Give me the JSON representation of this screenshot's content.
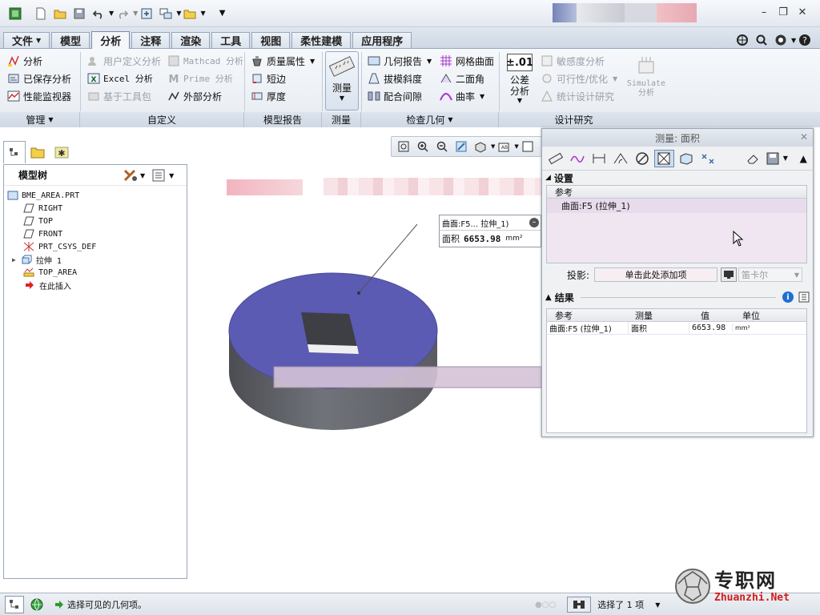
{
  "quick_access": {
    "icons": [
      "app-icon",
      "new-icon",
      "open-icon",
      "save-icon",
      "undo-icon",
      "redo-icon",
      "regenerate-icon",
      "windows-icon",
      "folder-icon",
      "more-icon"
    ]
  },
  "tabs": [
    "文件",
    "模型",
    "分析",
    "注释",
    "渲染",
    "工具",
    "视图",
    "柔性建模",
    "应用程序"
  ],
  "active_tab": "分析",
  "ribbon": {
    "manage": {
      "items": [
        "分析",
        "已保存分析",
        "性能监视器"
      ],
      "label": "管理"
    },
    "custom": {
      "col1": [
        "用户定义分析",
        "Excel 分析",
        "基于工具包"
      ],
      "col2": [
        "Mathcad 分析",
        "Prime 分析",
        "外部分析"
      ],
      "label": "自定义"
    },
    "model_report": {
      "items": [
        "质量属性",
        "短边",
        "厚度"
      ],
      "label": "模型报告"
    },
    "measure": {
      "label": "测量",
      "group": "测量"
    },
    "inspect": {
      "col1": [
        "几何报告",
        "拔模斜度",
        "配合间隙"
      ],
      "col2": [
        "网格曲面",
        "二面角",
        "曲率"
      ],
      "label": "检查几何"
    },
    "design_study": {
      "tolerance": "公差分析",
      "col2": [
        "敏感度分析",
        "可行性/优化",
        "统计设计研究"
      ],
      "simulate": "Simulate 分析",
      "tol_value": "±.01",
      "label": "设计研究"
    }
  },
  "model_tree": {
    "title": "模型树",
    "items": [
      {
        "label": "BME_AREA.PRT",
        "icon": "part-icon"
      },
      {
        "label": "RIGHT",
        "icon": "datum-plane-icon"
      },
      {
        "label": "TOP",
        "icon": "datum-plane-icon"
      },
      {
        "label": "FRONT",
        "icon": "datum-plane-icon"
      },
      {
        "label": "PRT_CSYS_DEF",
        "icon": "csys-icon"
      },
      {
        "label": "拉伸 1",
        "icon": "extrude-icon"
      },
      {
        "label": "TOP_AREA",
        "icon": "analysis-icon"
      },
      {
        "label": "在此插入",
        "icon": "insert-arrow-icon"
      }
    ]
  },
  "annotation": {
    "ref": "曲面:F5... 拉伸_1)",
    "area_label": "面积",
    "area_value": "6653.98",
    "unit": "mm²"
  },
  "dialog": {
    "title": "测量: 面积",
    "settings": "设置",
    "ref_header": "参考",
    "ref_item": "曲面:F5 (拉伸_1)",
    "projection_label": "投影:",
    "projection_field": "单击此处添加项",
    "coord_select": "笛卡尔",
    "results": "结果",
    "cols": [
      "参考",
      "测量",
      "值",
      "单位"
    ],
    "row": [
      "曲面:F5 (拉伸_1)",
      "面积",
      "6653.98",
      "mm²"
    ]
  },
  "status": {
    "message": "选择可见的几何项。",
    "selected": "选择了 1 项"
  },
  "watermark": {
    "cn": "专职网",
    "en": "Zhuanzhi.Net"
  },
  "colors": {
    "face": "#5c5cb3",
    "body": "#6f7177",
    "accent": "#2f6fc0"
  }
}
